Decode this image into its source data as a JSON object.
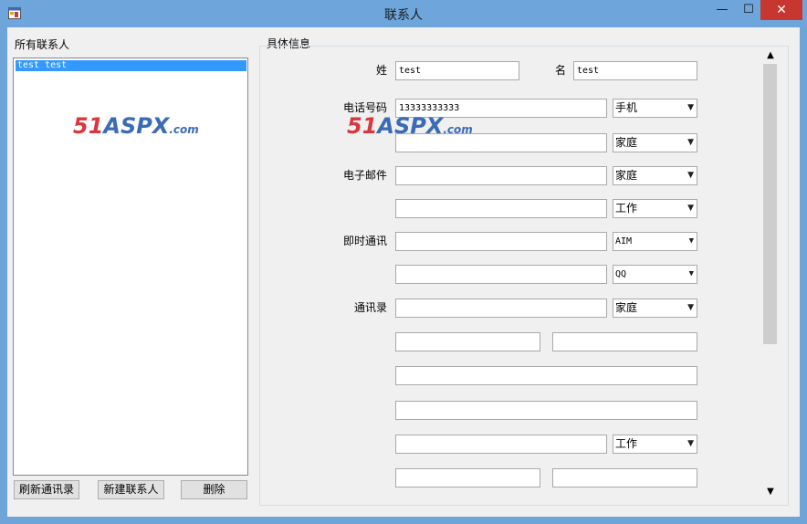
{
  "window": {
    "title": "联系人",
    "min_glyph": "—",
    "max_glyph": "☐",
    "close_glyph": "✕",
    "icon": "app-window-icon"
  },
  "left_group": {
    "label": "所有联系人",
    "items": [
      "test test"
    ],
    "selected_index": 0,
    "buttons": {
      "refresh": "刷新通讯录",
      "new": "新建联系人",
      "delete": "删除"
    }
  },
  "watermark": {
    "num": "51",
    "brand": "ASPX",
    "suffix": ".com"
  },
  "detail": {
    "label": "具体信息",
    "last_name_label": "姓",
    "last_name": "test",
    "first_name_label": "名",
    "first_name": "test",
    "phone_label": "电话号码",
    "phone1": "13333333333",
    "phone1_type": "手机",
    "phone2": "",
    "phone2_type": "家庭",
    "email_label": "电子邮件",
    "email1": "",
    "email1_type": "家庭",
    "email2": "",
    "email2_type": "工作",
    "im_label": "即时通讯",
    "im1": "",
    "im1_type": "AIM",
    "im2": "",
    "im2_type": "QQ",
    "address_label": "通讯录",
    "address1": "",
    "address1_type": "家庭",
    "address2a": "",
    "address2b": "",
    "address3": "",
    "address4": "",
    "address5": "",
    "address5_type": "工作",
    "address6a": "",
    "address6b": ""
  },
  "scrollbar": {
    "up": "▲",
    "down": "▼"
  },
  "colors": {
    "titlebar": "#6ea6dc",
    "selection": "#3399ff",
    "close": "#c7372f"
  }
}
